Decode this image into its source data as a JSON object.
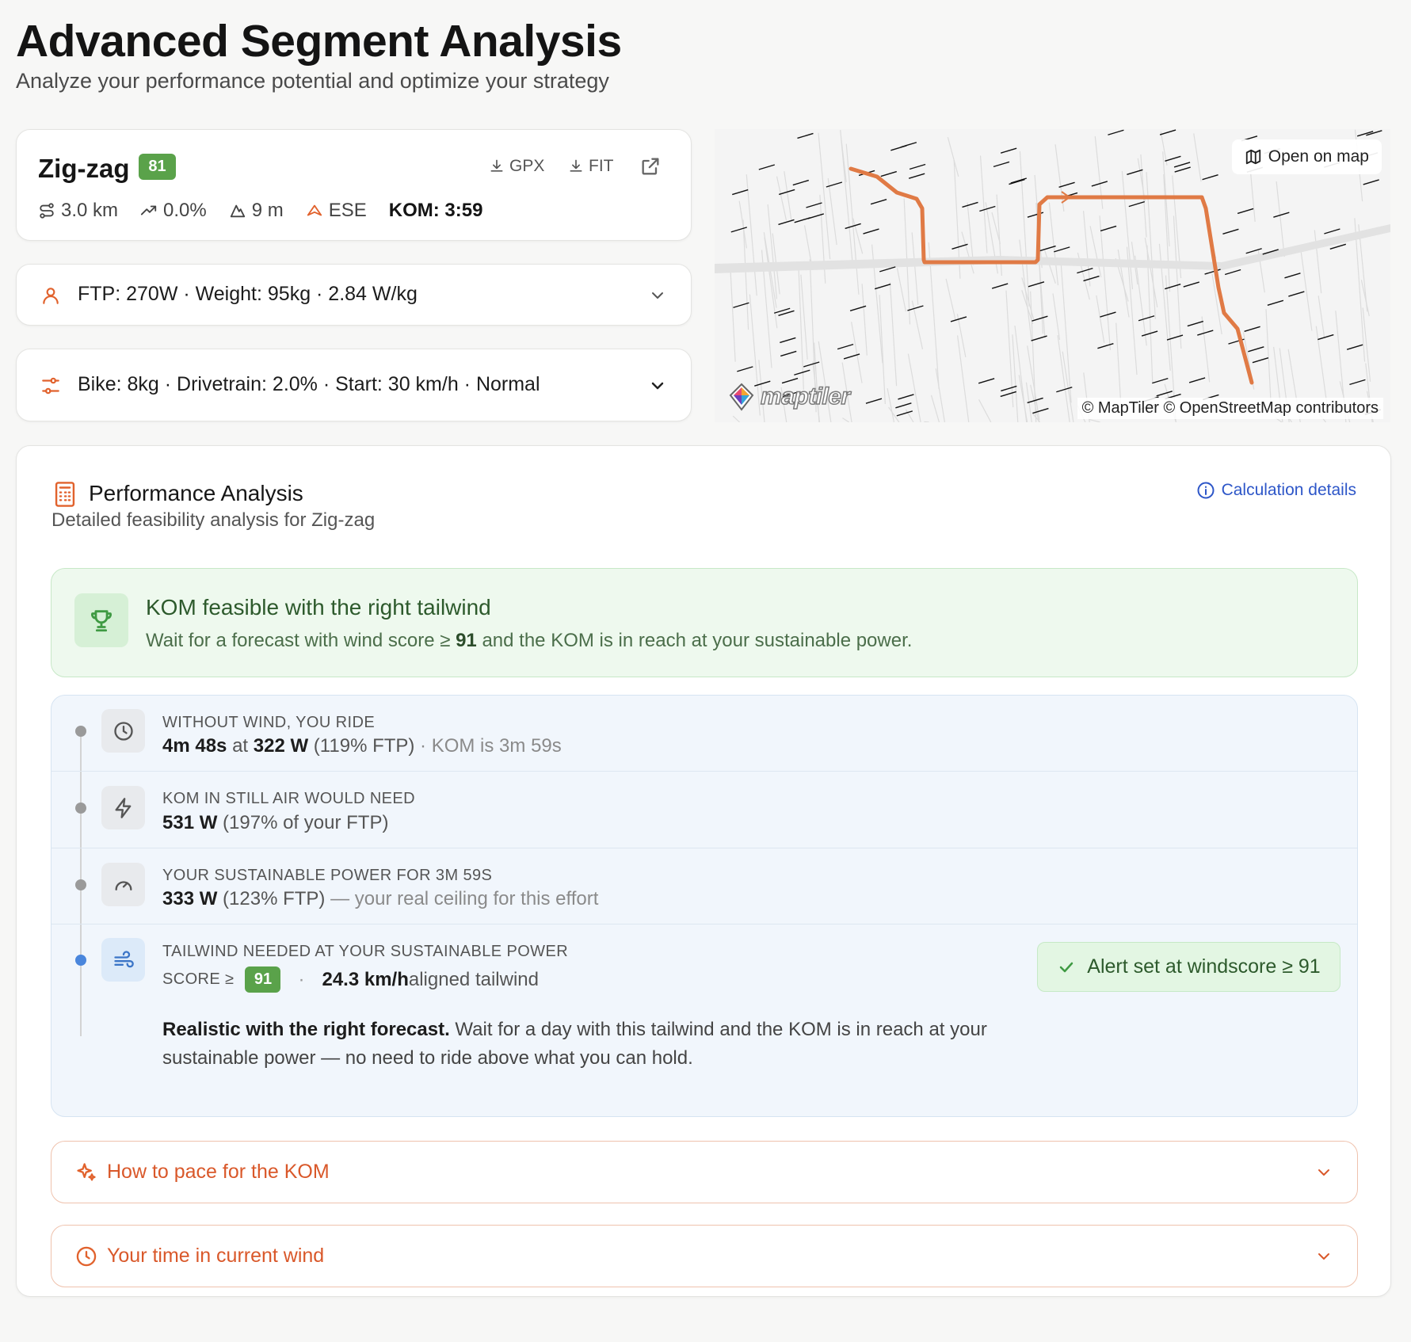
{
  "page": {
    "title": "Advanced Segment Analysis",
    "subtitle": "Analyze your performance potential and optimize your strategy"
  },
  "segment": {
    "name": "Zig-zag",
    "score": "81",
    "gpx_label": "GPX",
    "fit_label": "FIT",
    "distance": "3.0 km",
    "grade": "0.0%",
    "elevation": "9 m",
    "direction": "ESE",
    "kom": "KOM: 3:59"
  },
  "rider": {
    "summary": "FTP: 270W · Weight: 95kg · 2.84 W/kg"
  },
  "bike": {
    "summary": "Bike: 8kg · Drivetrain: 2.0% · Start: 30 km/h · Normal"
  },
  "map": {
    "open_label": "Open on map",
    "attribution": "© MapTiler © OpenStreetMap contributors",
    "logo_text": "maptiler",
    "route_color": "#e07a45"
  },
  "analysis": {
    "title": "Performance Analysis",
    "subtitle": "Detailed feasibility analysis for Zig-zag",
    "calc_link": "Calculation details",
    "verdict": {
      "title": "KOM feasible with the right tailwind",
      "text_pre": "Wait for a forecast with wind score ≥ ",
      "text_score": "91",
      "text_post": " and the KOM is in reach at your sustainable power."
    },
    "steps": [
      {
        "label": "WITHOUT WIND, YOU RIDE",
        "time": "4m 48s",
        "at": " at ",
        "power": "322 W",
        "pct": " (119% FTP)",
        "kom": " · KOM is 3m 59s"
      },
      {
        "label": "KOM IN STILL AIR WOULD NEED",
        "power": "531 W",
        "pct": " (197% of your FTP)"
      },
      {
        "label": "YOUR SUSTAINABLE POWER FOR 3M 59S",
        "power": "333 W",
        "pct": " (123% FTP)",
        "note": " — your real ceiling for this effort"
      },
      {
        "label": "TAILWIND NEEDED AT YOUR SUSTAINABLE POWER",
        "score_label": "SCORE ≥",
        "score": "91",
        "sep": "·",
        "wind": "24.3 km/h",
        "wind_suffix": " aligned tailwind",
        "desc_bold": "Realistic with the right forecast.",
        "desc": " Wait for a day with this tailwind and the KOM is in reach at your sustainable power — no need to ride above what you can hold.",
        "alert": "Alert set at windscore ≥ 91"
      }
    ],
    "accordions": [
      {
        "label": "How to pace for the KOM"
      },
      {
        "label": "Your time in current wind"
      }
    ]
  }
}
